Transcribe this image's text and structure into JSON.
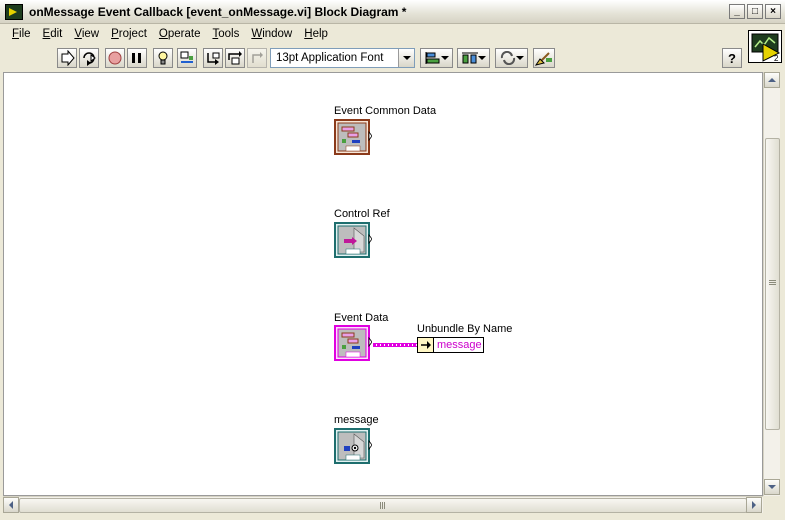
{
  "window": {
    "title": "onMessage Event Callback [event_onMessage.vi] Block Diagram *",
    "controls": {
      "minimize": "_",
      "maximize": "□",
      "close": "×"
    }
  },
  "menu": [
    {
      "id": "file",
      "accel": "F",
      "rest": "ile"
    },
    {
      "id": "edit",
      "accel": "E",
      "rest": "dit"
    },
    {
      "id": "view",
      "accel": "V",
      "rest": "iew"
    },
    {
      "id": "project",
      "accel": "P",
      "rest": "roject"
    },
    {
      "id": "operate",
      "accel": "O",
      "rest": "perate"
    },
    {
      "id": "tools",
      "accel": "T",
      "rest": "ools"
    },
    {
      "id": "window",
      "accel": "W",
      "rest": "indow"
    },
    {
      "id": "help",
      "accel": "H",
      "rest": "elp"
    }
  ],
  "toolbar": {
    "font": "13pt Application Font",
    "icons": [
      "run-icon",
      "run-continuously-icon",
      "abort-icon",
      "pause-icon",
      "highlight-execution-icon",
      "retain-wire-values-icon",
      "step-into-icon",
      "step-over-icon",
      "step-out-icon",
      "align-objects-icon",
      "distribute-objects-icon",
      "reorder-icon",
      "clean-up-diagram-icon",
      "context-help-icon"
    ]
  },
  "vi_icon": {
    "badge": "2"
  },
  "diagram": {
    "nodes": [
      {
        "id": "event-common-data",
        "label": "Event Common Data",
        "border_color": "#8B3A1A"
      },
      {
        "id": "control-ref",
        "label": "Control Ref",
        "border_color": "#1E6E6E"
      },
      {
        "id": "event-data",
        "label": "Event Data",
        "border_color": "#E000E0"
      },
      {
        "id": "message",
        "label": "message",
        "border_color": "#1E6E6E"
      }
    ],
    "unbundle": {
      "label": "Unbundle By Name",
      "field": "message"
    }
  },
  "colors": {
    "cluster_wire": "#E000E0",
    "string_text": "#CC00CC",
    "refnum": "#1E6E6E",
    "cluster_brown": "#8B3A1A"
  }
}
